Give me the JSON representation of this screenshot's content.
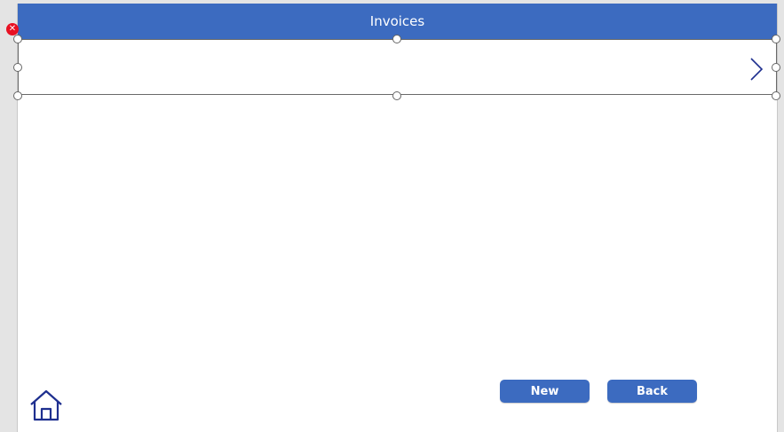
{
  "screen": {
    "title": "Invoices"
  },
  "buttons": {
    "new_label": "New",
    "back_label": "Back"
  },
  "icons": {
    "next": "chevron-right-icon",
    "home": "home-icon",
    "error": "error-icon"
  },
  "colors": {
    "accent": "#3c6bc0",
    "error": "#e81123",
    "icon_stroke": "#1e2f8f"
  }
}
